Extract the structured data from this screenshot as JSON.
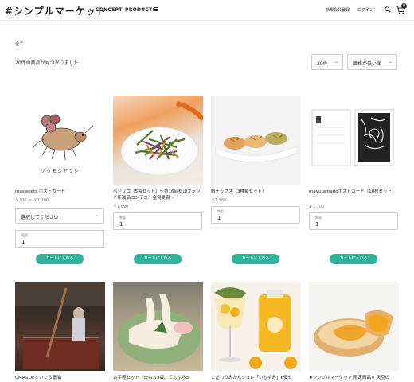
{
  "header": {
    "logo": "#シンプルマーケット",
    "nav": [
      "CONCEPT",
      "PRODUCTS"
    ],
    "register": "新規会員登録",
    "login": "ログイン",
    "cart_count": "0"
  },
  "breadcrumb": "全て",
  "result_count": "20件の商品が見つかりました",
  "per_page": "20件",
  "sort": "価格が低い順",
  "quantity_label": "数量",
  "quantity_value": "1",
  "add_to_cart": "カートに入れる",
  "products": [
    {
      "name": "musweets ポストカード",
      "price": "￥300 ～ ￥1,200",
      "option_placeholder": "選択してください",
      "image_text": "ゾウモシアラシ"
    },
    {
      "name": "ベジリコ（5袋セット）～第16回松山ブランド新製品コンテスト金賞受賞～",
      "price": "￥1,690"
    },
    {
      "name": "鯛チップス（3種類セット）",
      "price": "￥1,960"
    },
    {
      "name": "mayutamagoポストカード（10枚セット）",
      "price": "￥2,100"
    },
    {
      "name": "UMAGOEといくら醤油"
    },
    {
      "name": "お手軽セット（白もち3袋、てんぷら3"
    },
    {
      "name": "こだわりみかんジュレ「いちずみ」6個セ"
    },
    {
      "name": "★シンプルマーケット 限定商品★ 天空の"
    }
  ],
  "colors": {
    "accent": "#2fb39a",
    "text": "#222222",
    "border": "#cccccc"
  }
}
